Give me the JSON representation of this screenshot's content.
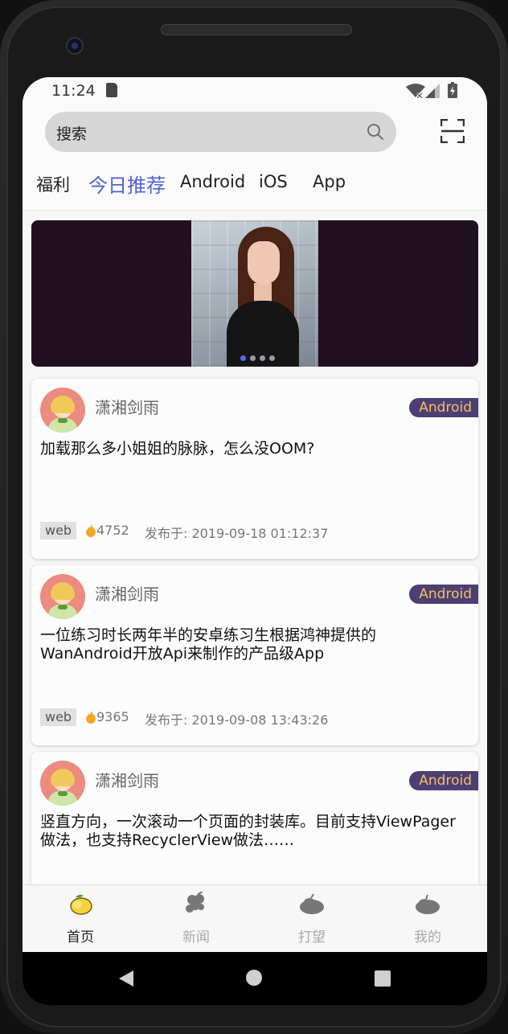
{
  "status_bar": {
    "time": "11:24"
  },
  "search": {
    "placeholder": "搜索"
  },
  "tabs": [
    {
      "label": "福利"
    },
    {
      "label": "今日推荐",
      "active": true
    },
    {
      "label": "Android"
    },
    {
      "label": "iOS"
    },
    {
      "label": "App"
    }
  ],
  "banner": {
    "page_count": 4,
    "active_page": 1
  },
  "articles": [
    {
      "author": "潇湘剑雨",
      "tag": "Android",
      "title": "加载那么多小姐姐的脉脉，怎么没OOM?",
      "badge": "web",
      "count": "4752",
      "date": "发布于:   2019-09-18 01:12:37"
    },
    {
      "author": "潇湘剑雨",
      "tag": "Android",
      "title": "一位练习时长两年半的安卓练习生根据鸿神提供的WanAndroid开放Api来制作的产品级App",
      "badge": "web",
      "count": "9365",
      "date": "发布于:   2019-09-08 13:43:26"
    },
    {
      "author": "潇湘剑雨",
      "tag": "Android",
      "title": "竖直方向，一次滚动一个页面的封装库。目前支持ViewPager做法，也支持RecyclerView做法……",
      "badge": "",
      "count": "",
      "date": ""
    }
  ],
  "bottom_nav": [
    {
      "label": "首页",
      "active": true,
      "icon": "lemon-icon"
    },
    {
      "label": "新闻",
      "active": false,
      "icon": "grape-icon"
    },
    {
      "label": "打望",
      "active": false,
      "icon": "fruit-icon"
    },
    {
      "label": "我的",
      "active": false,
      "icon": "fruit-icon"
    }
  ],
  "colors": {
    "accent": "#5262d0",
    "tag_bg": "#4d3f73",
    "tag_text": "#f0c060",
    "banner_bg": "#201021"
  }
}
